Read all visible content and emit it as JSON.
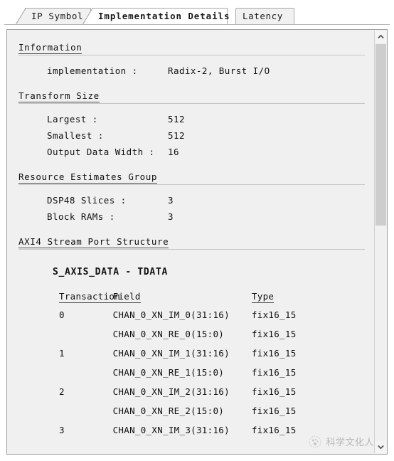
{
  "tabs": [
    {
      "id": "ip-symbol",
      "label": "IP Symbol",
      "active": false
    },
    {
      "id": "implementation-details",
      "label": "Implementation Details",
      "active": true
    },
    {
      "id": "latency",
      "label": "Latency",
      "active": false
    }
  ],
  "sections": {
    "information": {
      "title": "Information",
      "rows": [
        {
          "key": "implementation :",
          "value": "Radix-2, Burst I/O"
        }
      ]
    },
    "transform_size": {
      "title": "Transform Size",
      "rows": [
        {
          "key": "Largest :",
          "value": "512"
        },
        {
          "key": "Smallest :",
          "value": "512"
        },
        {
          "key": "Output Data Width :",
          "value": "16"
        }
      ]
    },
    "resource_estimates": {
      "title": "Resource Estimates Group",
      "rows": [
        {
          "key": "DSP48 Slices :",
          "value": "3"
        },
        {
          "key": "Block RAMs :",
          "value": "3"
        }
      ]
    },
    "axi4_stream": {
      "title": "AXI4 Stream Port Structure",
      "subhead": "S_AXIS_DATA - TDATA",
      "columns": [
        "Transaction",
        "Field",
        "Type"
      ],
      "rows": [
        {
          "transaction": "0",
          "field": "CHAN_0_XN_IM_0(31:16)",
          "type": "fix16_15"
        },
        {
          "transaction": "",
          "field": "CHAN_0_XN_RE_0(15:0)",
          "type": "fix16_15"
        },
        {
          "transaction": "1",
          "field": "CHAN_0_XN_IM_1(31:16)",
          "type": "fix16_15"
        },
        {
          "transaction": "",
          "field": "CHAN_0_XN_RE_1(15:0)",
          "type": "fix16_15"
        },
        {
          "transaction": "2",
          "field": "CHAN_0_XN_IM_2(31:16)",
          "type": "fix16_15"
        },
        {
          "transaction": "",
          "field": "CHAN_0_XN_RE_2(15:0)",
          "type": "fix16_15"
        },
        {
          "transaction": "3",
          "field": "CHAN_0_XN_IM_3(31:16)",
          "type": "fix16_15"
        }
      ]
    }
  },
  "scrollbar": {
    "up_arrow": "chevron-up-icon",
    "down_arrow": "chevron-down-icon",
    "thumb_top_pct": "3",
    "thumb_height_pct": "43"
  },
  "watermark": {
    "text": "科学文化人",
    "logo": "paw-logo-icon"
  },
  "colors": {
    "panel_bg": "#f0f0f0",
    "tab_bg": "#f1f1f1",
    "active_tab_bg": "#ffffff",
    "border": "#a0a0a0",
    "text": "#111111",
    "rule": "#c6c6c6",
    "scroll_thumb": "#cdcdcd"
  }
}
